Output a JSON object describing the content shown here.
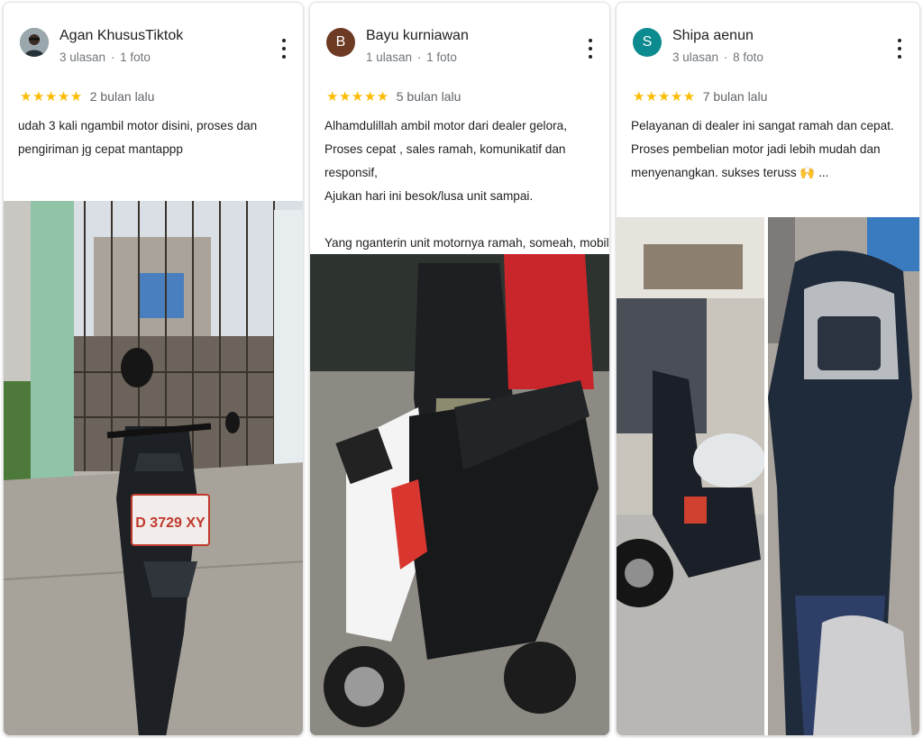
{
  "reviews": [
    {
      "name": "Agan KhususTiktok",
      "ulasan": "3 ulasan",
      "foto": "1 foto",
      "separator": "·",
      "stars": "★★★★★",
      "when": "2 bulan lalu",
      "text": "udah 3 kali ngambil motor disini, proses dan\npengiriman jg cepat mantappp",
      "avatar_color": "#37474f",
      "photo_plate": "D 3729 XY"
    },
    {
      "name": "Bayu kurniawan",
      "ulasan": "1 ulasan",
      "foto": "1 foto",
      "separator": "·",
      "stars": "★★★★★",
      "when": "5 bulan lalu",
      "avatar_letter": "B",
      "avatar_color": "#6d3a24",
      "text": "Alhamdulillah ambil motor dari dealer gelora,\nProses cepat , sales ramah, komunikatif dan responsif,\nAjukan hari ini besok/lusa unit sampai.\n\nYang nganterin unit motornya ramah, someah, mobil\npengantar motornya bersih , baru, mantap ."
    },
    {
      "name": "Shipa aenun",
      "ulasan": "3 ulasan",
      "foto": "8 foto",
      "separator": "·",
      "stars": "★★★★★",
      "when": "7 bulan lalu",
      "avatar_letter": "S",
      "avatar_color": "#0b8a8f",
      "text": "Pelayanan di dealer ini sangat ramah dan cepat.\nProses pembelian motor jadi lebih mudah dan\nmenyenangkan. sukses teruss 🙌 ..."
    }
  ],
  "colors": {
    "star": "#fbbc04",
    "meta_text": "#70757a"
  }
}
